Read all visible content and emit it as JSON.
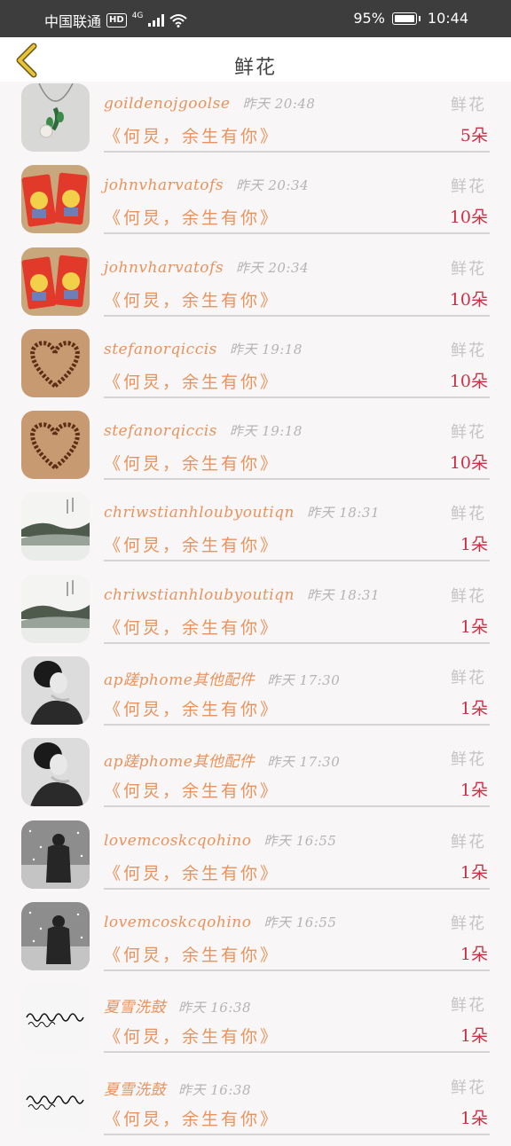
{
  "status_bar": {
    "carrier": "中国联通",
    "hd": "HD",
    "network": "4G",
    "battery": "95%",
    "time": "10:44"
  },
  "header": {
    "title": "鲜花",
    "back_icon": "chevron-left-icon"
  },
  "colors": {
    "accent": "#e8935d",
    "quantity": "#cf2f45",
    "muted": "#b4b4b4",
    "statusbar": "#3d3d3d"
  },
  "items": [
    {
      "name": "goildenojgoolse",
      "time": "昨天 20:48",
      "category": "鲜花",
      "message": "《何炅，余生有你》",
      "qty": "5朵",
      "avatar": "necklace"
    },
    {
      "name": "johnvharvatofs",
      "time": "昨天 20:34",
      "category": "鲜花",
      "message": "《何炅，余生有你》",
      "qty": "10朵",
      "avatar": "red-envelopes"
    },
    {
      "name": "johnvharvatofs",
      "time": "昨天 20:34",
      "category": "鲜花",
      "message": "《何炅，余生有你》",
      "qty": "10朵",
      "avatar": "red-envelopes"
    },
    {
      "name": "stefanorqiccis",
      "time": "昨天 19:18",
      "category": "鲜花",
      "message": "《何炅，余生有你》",
      "qty": "10朵",
      "avatar": "bead-heart"
    },
    {
      "name": "stefanorqiccis",
      "time": "昨天 19:18",
      "category": "鲜花",
      "message": "《何炅，余生有你》",
      "qty": "10朵",
      "avatar": "bead-heart"
    },
    {
      "name": "chriwstianhloubyoutiqn",
      "time": "昨天 18:31",
      "category": "鲜花",
      "message": "《何炅，余生有你》",
      "qty": "1朵",
      "avatar": "ink-landscape"
    },
    {
      "name": "chriwstianhloubyoutiqn",
      "time": "昨天 18:31",
      "category": "鲜花",
      "message": "《何炅，余生有你》",
      "qty": "1朵",
      "avatar": "ink-landscape"
    },
    {
      "name": "ap蹉phome其他配件",
      "time": "昨天 17:30",
      "category": "鲜花",
      "message": "《何炅，余生有你》",
      "qty": "1朵",
      "avatar": "bw-portrait"
    },
    {
      "name": "ap蹉phome其他配件",
      "time": "昨天 17:30",
      "category": "鲜花",
      "message": "《何炅，余生有你》",
      "qty": "1朵",
      "avatar": "bw-portrait"
    },
    {
      "name": "lovemcoskcqohino",
      "time": "昨天 16:55",
      "category": "鲜花",
      "message": "《何炅，余生有你》",
      "qty": "1朵",
      "avatar": "snow-figure"
    },
    {
      "name": "lovemcoskcqohino",
      "time": "昨天 16:55",
      "category": "鲜花",
      "message": "《何炅，余生有你》",
      "qty": "1朵",
      "avatar": "snow-figure"
    },
    {
      "name": "夏雪洗鼓",
      "time": "昨天 16:38",
      "category": "鲜花",
      "message": "《何炅，余生有你》",
      "qty": "1朵",
      "avatar": "calligraphy"
    },
    {
      "name": "夏雪洗鼓",
      "time": "昨天 16:38",
      "category": "鲜花",
      "message": "《何炅，余生有你》",
      "qty": "1朵",
      "avatar": "calligraphy"
    }
  ]
}
